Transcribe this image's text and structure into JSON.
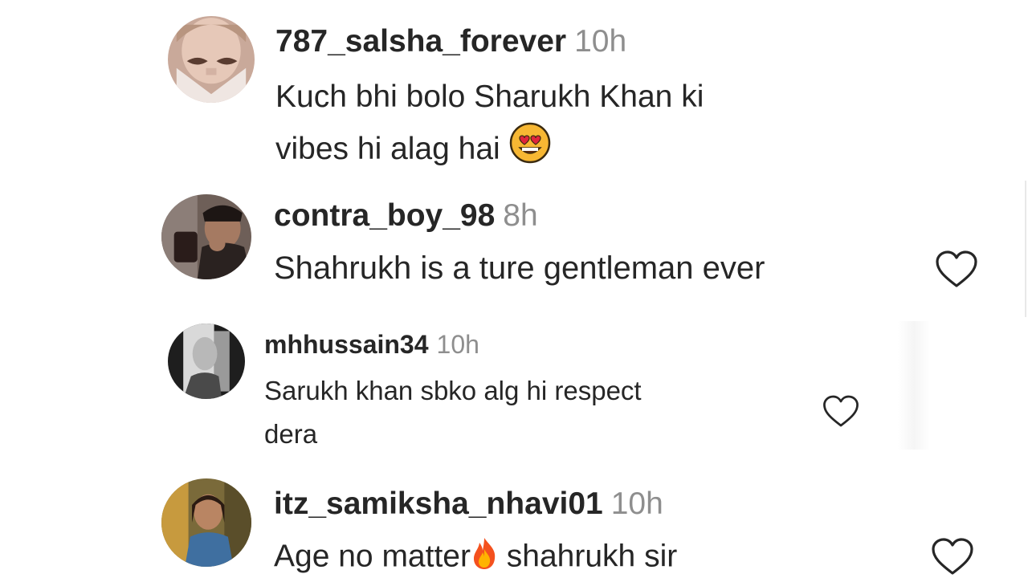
{
  "comments": [
    {
      "username": "787_salsha_forever",
      "time": "10h",
      "text": "Kuch bhi bolo Sharukh Khan ki\nvibes hi alag hai",
      "emoji": "heart-eyes-emoji"
    },
    {
      "username": "contra_boy_98",
      "time": "8h",
      "text": "Shahrukh is a ture gentleman ever"
    },
    {
      "username": "mhhussain34",
      "time": "10h",
      "text": "Sarukh khan sbko alg hi respect\ndera"
    },
    {
      "username": "itz_samiksha_nhavi01",
      "time": "10h",
      "text_before": "Age no matter",
      "text_after": " shahrukh sir",
      "emoji": "fire-emoji"
    }
  ],
  "icons": {
    "like": "heart-outline-icon"
  },
  "colors": {
    "text": "#262626",
    "secondary": "#8e8e8e"
  }
}
